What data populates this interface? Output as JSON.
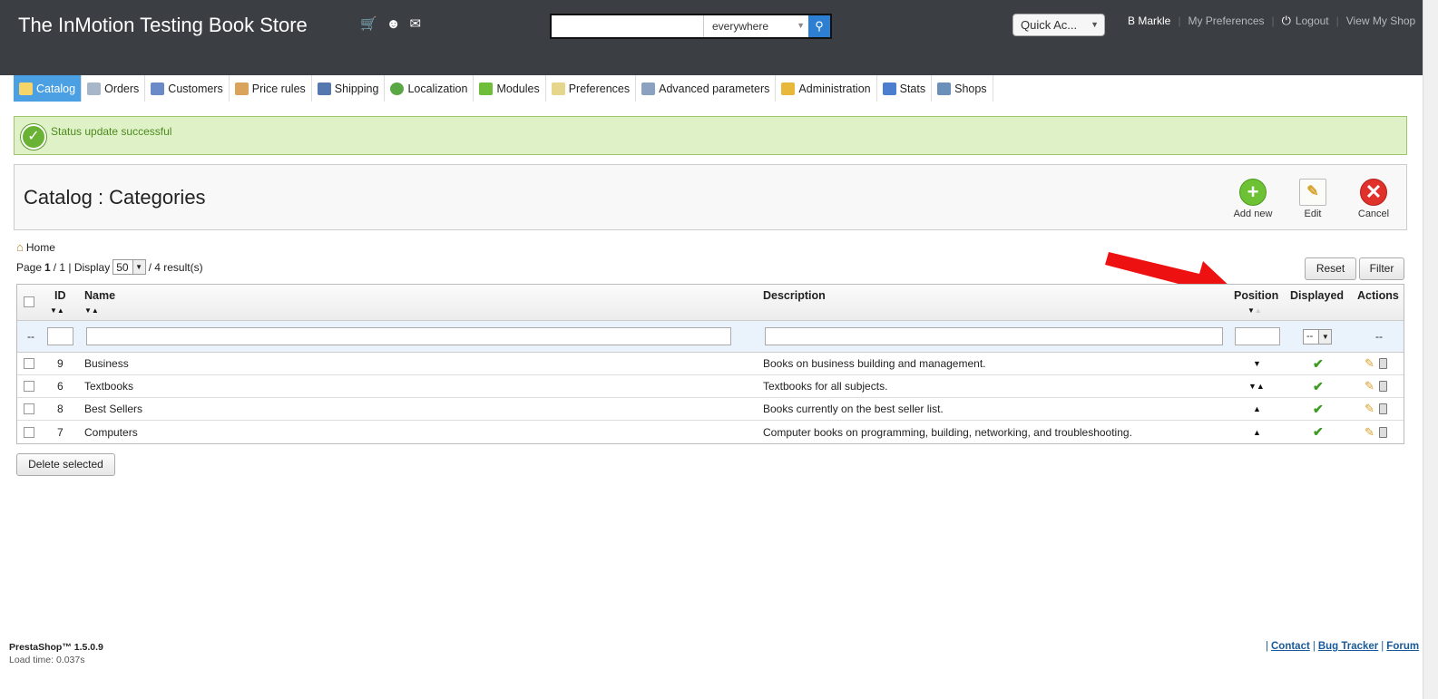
{
  "header": {
    "shop_title": "The InMotion Testing Book Store",
    "search": {
      "value": "",
      "scope": "everywhere"
    },
    "quick_access": "Quick Ac...",
    "user_name": "B Markle",
    "my_preferences": "My Preferences",
    "logout": "Logout",
    "view_my_shop": "View My Shop",
    "bg_color": "#3b3f44"
  },
  "tabs": [
    {
      "label": "Catalog",
      "icon": "catalog-icon",
      "active": true
    },
    {
      "label": "Orders",
      "icon": "orders-icon"
    },
    {
      "label": "Customers",
      "icon": "customers-icon"
    },
    {
      "label": "Price rules",
      "icon": "price-rules-icon"
    },
    {
      "label": "Shipping",
      "icon": "shipping-icon"
    },
    {
      "label": "Localization",
      "icon": "localization-icon"
    },
    {
      "label": "Modules",
      "icon": "modules-icon"
    },
    {
      "label": "Preferences",
      "icon": "preferences-icon"
    },
    {
      "label": "Advanced parameters",
      "icon": "advanced-parameters-icon"
    },
    {
      "label": "Administration",
      "icon": "administration-icon"
    },
    {
      "label": "Stats",
      "icon": "stats-icon"
    },
    {
      "label": "Shops",
      "icon": "shops-icon"
    }
  ],
  "notice": {
    "text": "Status update successful"
  },
  "page": {
    "title": "Catalog : Categories",
    "toolbar": {
      "add_new": "Add new",
      "edit": "Edit",
      "cancel": "Cancel"
    },
    "breadcrumb": "Home"
  },
  "pager": {
    "page_label": "Page",
    "current": "1",
    "total_text": " / 1 | Display ",
    "per_page": "50",
    "results_text": " / 4 result(s)"
  },
  "buttons": {
    "reset": "Reset",
    "filter": "Filter",
    "delete_selected": "Delete selected"
  },
  "table": {
    "columns": {
      "id": "ID",
      "name": "Name",
      "description": "Description",
      "position": "Position",
      "displayed": "Displayed",
      "actions": "Actions"
    },
    "filter": {
      "dashes": "--",
      "displayed": "--",
      "actions": "--"
    },
    "rows": [
      {
        "id": "9",
        "name": "Business",
        "description": "Books on business building and management.",
        "pos": "▼"
      },
      {
        "id": "6",
        "name": "Textbooks",
        "description": "Textbooks for all subjects.",
        "pos": "▼▲"
      },
      {
        "id": "8",
        "name": "Best Sellers",
        "description": "Books currently on the best seller list.",
        "pos": "▲"
      },
      {
        "id": "7",
        "name": "Computers",
        "description": "Computer books on programming, building, networking, and troubleshooting.",
        "pos": "▲"
      }
    ]
  },
  "footer": {
    "version": "PrestaShop™ 1.5.0.9",
    "load_time": "Load time: 0.037s",
    "contact": "Contact",
    "bug_tracker": "Bug Tracker",
    "forum": "Forum"
  }
}
